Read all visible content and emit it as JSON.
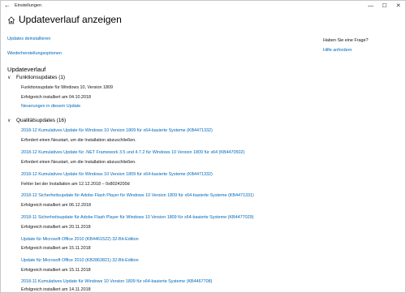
{
  "window": {
    "title": "Einstellungen",
    "back": "←",
    "min": "—",
    "max": "☐",
    "close": "✕"
  },
  "header": {
    "title": "Updateverlauf anzeigen"
  },
  "links": {
    "uninstall": "Updates deinstallieren",
    "recovery": "Wiederherstellungsoptionen"
  },
  "aside": {
    "question": "Haben Sie eine Frage?",
    "help": "Hilfe anfordern"
  },
  "section": {
    "title": "Updateverlauf"
  },
  "feature": {
    "header": "Funktionsupdates (1)",
    "items": [
      {
        "title": "Funktionsupdate für Windows 10, Version 1809",
        "status": "Erfolgreich installiert am 04.10.2018",
        "link": "Neuerungen in diesem Update"
      }
    ]
  },
  "quality": {
    "header": "Qualitätsupdates (16)",
    "items": [
      {
        "title": "2018-12 Kumulatives Update für Windows 10 Version 1809 für x64-basierte Systeme (KB4471332)",
        "status": "Erfordert einen Neustart, um die Installation abzuschließen."
      },
      {
        "title": "2018-12 Kumulatives Update für .NET Framework 3.5 und 4.7.2 für Windows 10 Version 1809 für x64 (KB4470502)",
        "status": "Erfordert einen Neustart, um die Installation abzuschließen."
      },
      {
        "title": "2018-12 Kumulatives Update für Windows 10 Version 1809 für x64-basierte Systeme (KB4471332)",
        "status": "Fehler bei der Installation am 12.12.2018 – 0x8024200d"
      },
      {
        "title": "2018-12 Sicherheitsupdate für Adobe Flash Player für Windows 10 Version 1809 für x64-basierte Systeme (KB4471331)",
        "status": "Erfolgreich installiert am 06.12.2018"
      },
      {
        "title": "2018-11 Sicherheitsupdate für Adobe Flash Player für Windows 10 Version 1809 für x64-basierte Systeme (KB4477029)",
        "status": "Erfolgreich installiert am 20.11.2018"
      },
      {
        "title": "Update für Microsoft Office 2010 (KB4461522) 32-Bit-Edition",
        "status": "Erfolgreich installiert am 15.11.2018"
      },
      {
        "title": "Update für Microsoft Office 2010 (KB2863821) 32-Bit-Edition",
        "status": "Erfolgreich installiert am 15.11.2018"
      },
      {
        "title": "2018-11 Kumulatives Update für Windows 10 Version 1809 für x64-basierte Systeme (KB4467708)",
        "status": "Erfolgreich installiert am 14.11.2018"
      }
    ]
  },
  "colors": {
    "accent": "#0067b8",
    "text": "#111111"
  }
}
